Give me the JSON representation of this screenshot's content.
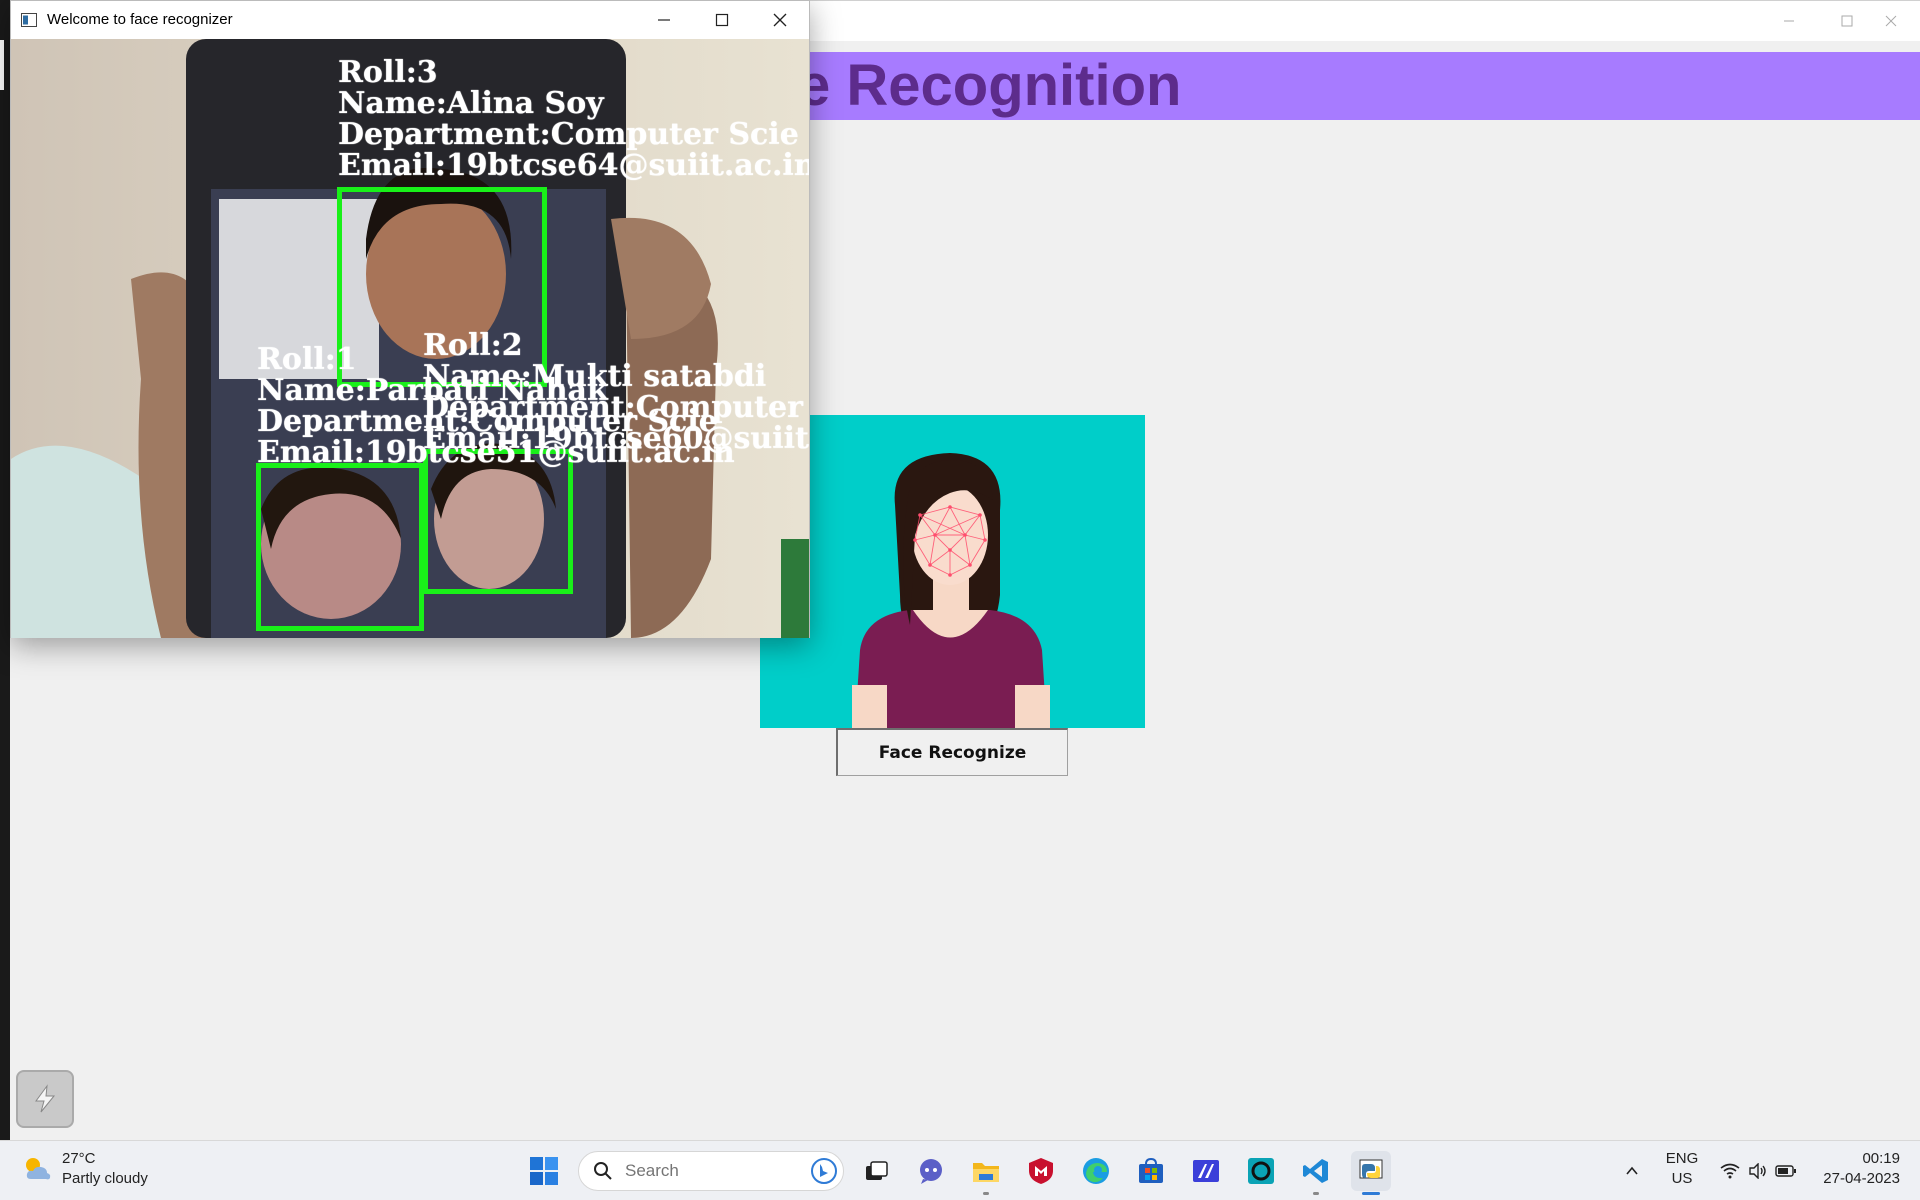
{
  "main_window": {
    "banner_title": "e Recognition",
    "button_label": "Face Recognize",
    "banner_color": "#a77bff",
    "title_color": "#5d2c8c",
    "illustration_bg": "#00cec9"
  },
  "cam_window": {
    "title": "Welcome to face recognizer",
    "detections": [
      {
        "lines": [
          "Roll:3",
          "Name:Alina Soy",
          "Department:Computer Scie",
          "Email:19btcse64@suiit.ac.in"
        ]
      },
      {
        "lines": [
          "Roll:2",
          "Name:Mukti satabdi",
          "Department:Computer",
          "Email:19btcse60@suiit."
        ]
      },
      {
        "lines": [
          "Roll:1",
          "Name:Parbati Nahak",
          "Department:Computer Scie",
          "Email:19btcse51@suiit.ac.in"
        ]
      }
    ],
    "box_color": "#19f019"
  },
  "taskbar": {
    "weather_temp": "27°C",
    "weather_desc": "Partly cloudy",
    "search_placeholder": "Search",
    "lang_top": "ENG",
    "lang_bottom": "US",
    "time": "00:19",
    "date": "27-04-2023",
    "icons": [
      "start-icon",
      "task-view-icon",
      "chat-icon",
      "file-explorer-icon",
      "mcafee-icon",
      "edge-icon",
      "store-icon",
      "app-icon",
      "cortana-icon",
      "vscode-icon",
      "python-icon"
    ]
  }
}
